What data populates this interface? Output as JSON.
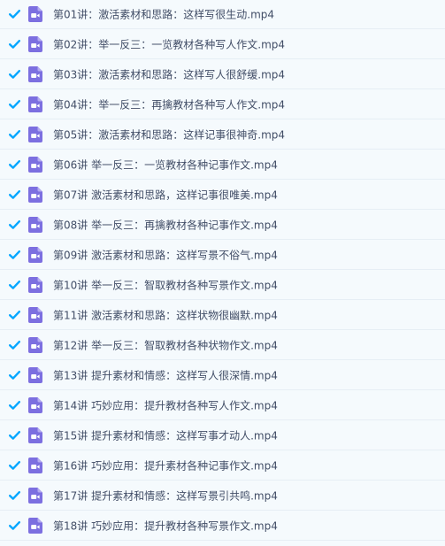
{
  "colors": {
    "background": "#f5fafd",
    "checkbox": "#06a7ff",
    "video_icon": "#7c6fe0",
    "text": "#424e67",
    "divider": "#e6eef5"
  },
  "files": [
    {
      "name": "第01讲：激活素材和思路：这样写很生动.mp4",
      "checked": true,
      "icon": "video-file-icon"
    },
    {
      "name": "第02讲：举一反三：一览教材各种写人作文.mp4",
      "checked": true,
      "icon": "video-file-icon"
    },
    {
      "name": "第03讲：激活素材和思路：这样写人很舒缓.mp4",
      "checked": true,
      "icon": "video-file-icon"
    },
    {
      "name": "第04讲：举一反三：再擒教材各种写人作文.mp4",
      "checked": true,
      "icon": "video-file-icon"
    },
    {
      "name": "第05讲：激活素材和思路：这样记事很神奇.mp4",
      "checked": true,
      "icon": "video-file-icon"
    },
    {
      "name": "第06讲 举一反三：一览教材各种记事作文.mp4",
      "checked": true,
      "icon": "video-file-icon"
    },
    {
      "name": "第07讲 激活素材和思路，这样记事很唯美.mp4",
      "checked": true,
      "icon": "video-file-icon"
    },
    {
      "name": "第08讲 举一反三：再擒教材各种记事作文.mp4",
      "checked": true,
      "icon": "video-file-icon"
    },
    {
      "name": "第09讲 激活素材和思路：这样写景不俗气.mp4",
      "checked": true,
      "icon": "video-file-icon"
    },
    {
      "name": "第10讲 举一反三：智取教材各种写景作文.mp4",
      "checked": true,
      "icon": "video-file-icon"
    },
    {
      "name": "第11讲 激活素材和思路：这样状物很幽默.mp4",
      "checked": true,
      "icon": "video-file-icon"
    },
    {
      "name": "第12讲 举一反三：智取教材各种状物作文.mp4",
      "checked": true,
      "icon": "video-file-icon"
    },
    {
      "name": "第13讲 提升素材和情感：这样写人很深情.mp4",
      "checked": true,
      "icon": "video-file-icon"
    },
    {
      "name": "第14讲 巧妙应用：提升教材各种写人作文.mp4",
      "checked": true,
      "icon": "video-file-icon"
    },
    {
      "name": "第15讲 提升素材和情感：这样写事才动人.mp4",
      "checked": true,
      "icon": "video-file-icon"
    },
    {
      "name": "第16讲 巧妙应用：提升素材各种记事作文.mp4",
      "checked": true,
      "icon": "video-file-icon"
    },
    {
      "name": "第17讲 提升素材和情感：这样写景引共鸣.mp4",
      "checked": true,
      "icon": "video-file-icon"
    },
    {
      "name": "第18讲 巧妙应用：提升教材各种写景作文.mp4",
      "checked": true,
      "icon": "video-file-icon"
    }
  ]
}
